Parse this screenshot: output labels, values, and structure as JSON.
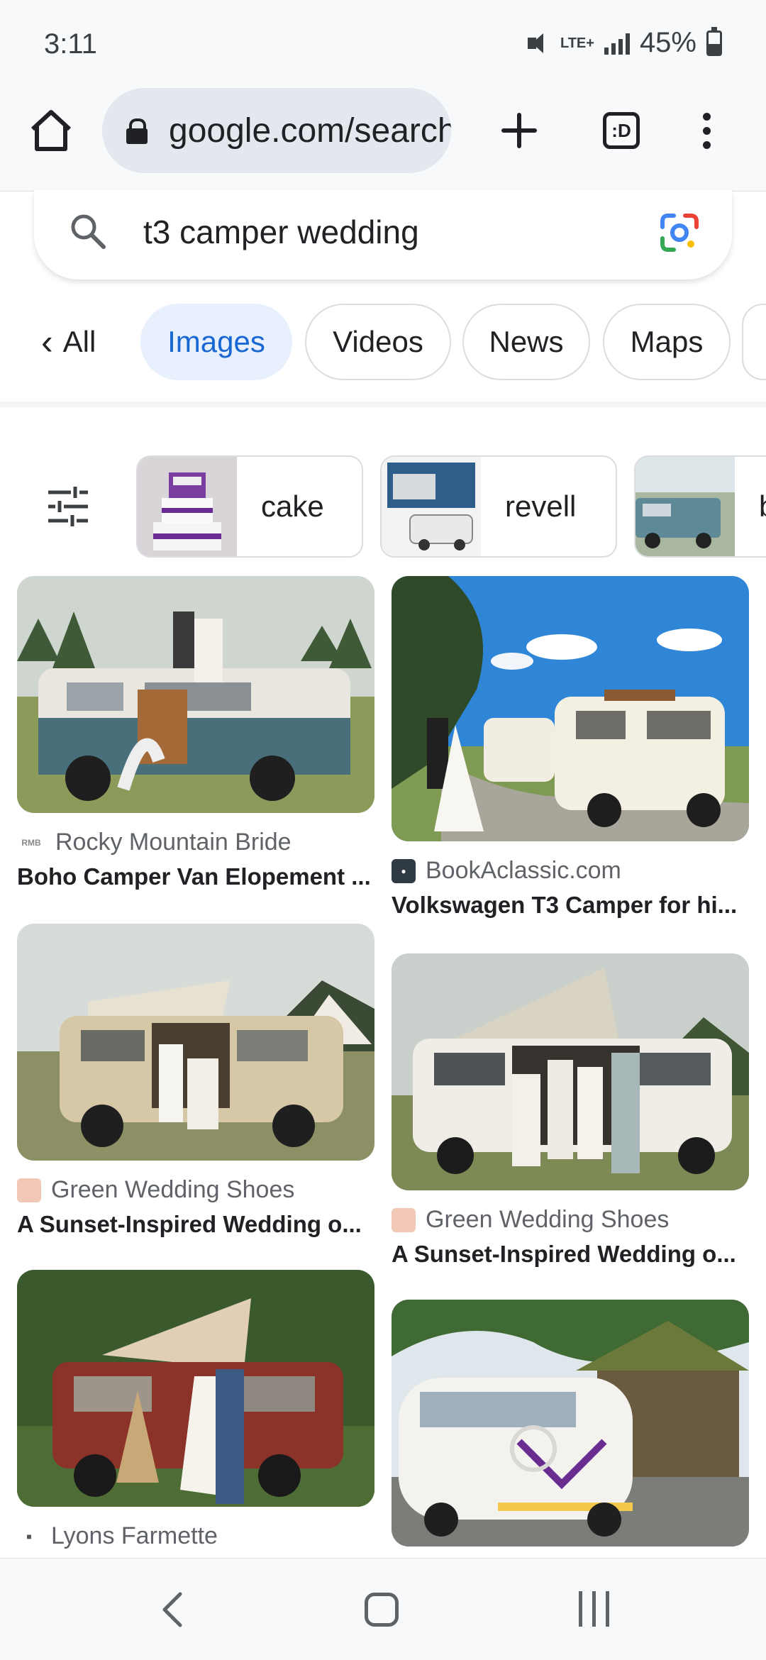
{
  "status_bar": {
    "time": "3:11",
    "network": "LTE+",
    "battery": "45%"
  },
  "browser": {
    "url": "google.com/search",
    "tabs_count": ":D"
  },
  "search": {
    "query": "t3 camper wedding"
  },
  "filters": {
    "all_label": "All",
    "tabs": [
      "Images",
      "Videos",
      "News",
      "Maps"
    ],
    "active": "Images"
  },
  "refinements": [
    "cake",
    "revell",
    "b"
  ],
  "results": {
    "left": [
      {
        "source": "Rocky Mountain Bride",
        "favicon": "RMB",
        "title": "Boho Camper Van Elopement ..."
      },
      {
        "source": "Green Wedding Shoes",
        "favicon": "rainbow",
        "title": "A Sunset-Inspired Wedding o..."
      },
      {
        "source": "Lyons Farmette",
        "favicon": "tractor",
        "title": ""
      }
    ],
    "right": [
      {
        "source": "BookAclassic.com",
        "favicon": "car",
        "title": "Volkswagen T3 Camper for hi..."
      },
      {
        "source": "Green Wedding Shoes",
        "favicon": "rainbow",
        "title": "A Sunset-Inspired Wedding o..."
      }
    ]
  },
  "colors": {
    "accent": "#1967d2",
    "chip_active_bg": "#e8f0fe"
  }
}
